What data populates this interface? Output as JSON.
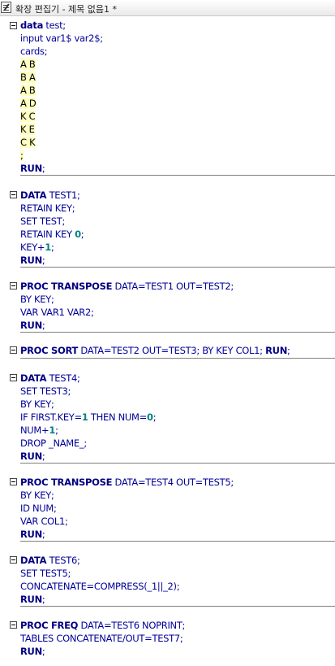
{
  "window": {
    "title": "확장 편집기 - 제목 없음1 *"
  },
  "lines": {
    "l1": {
      "kw": "data",
      "rest": " test;"
    },
    "l2": {
      "text": "input var1$ var2$;"
    },
    "l3": {
      "text": "cards;"
    },
    "l4": {
      "text": "A B"
    },
    "l5": {
      "text": "B A"
    },
    "l6": {
      "text": "A B"
    },
    "l7": {
      "text": "A D"
    },
    "l8": {
      "text": "K C"
    },
    "l9": {
      "text": "K E"
    },
    "l10": {
      "text": "C K"
    },
    "l11": {
      "text": ";"
    },
    "l12": {
      "kw": "RUN",
      "rest": ";"
    },
    "l13": {
      "kw": "DATA",
      "rest": " TEST1;"
    },
    "l14": {
      "text": "RETAIN KEY;"
    },
    "l15": {
      "text": "SET TEST;"
    },
    "l16": {
      "a": "RETAIN KEY ",
      "n": "0",
      "b": ";"
    },
    "l17": {
      "a": "KEY+",
      "n": "1",
      "b": ";"
    },
    "l18": {
      "kw": "RUN",
      "rest": ";"
    },
    "l19": {
      "kw": "PROC TRANSPOSE",
      "rest": " DATA=TEST1 OUT=TEST2;"
    },
    "l20": {
      "text": "BY KEY;"
    },
    "l21": {
      "text": "VAR VAR1 VAR2;"
    },
    "l22": {
      "kw": "RUN",
      "rest": ";"
    },
    "l23": {
      "kw": "PROC SORT",
      "rest": " DATA=TEST2 OUT=TEST3; BY KEY COL1; ",
      "kw2": "RUN",
      "rest2": ";"
    },
    "l24": {
      "kw": "DATA",
      "rest": " TEST4;"
    },
    "l25": {
      "text": "SET TEST3;"
    },
    "l26": {
      "text": "BY KEY;"
    },
    "l27": {
      "a": "IF FIRST.KEY=",
      "n": "1",
      "b": " THEN NUM=",
      "n2": "0",
      "c": ";"
    },
    "l28": {
      "a": "NUM+",
      "n": "1",
      "b": ";"
    },
    "l29": {
      "text": "DROP _NAME_;"
    },
    "l30": {
      "kw": "RUN",
      "rest": ";"
    },
    "l31": {
      "kw": "PROC TRANSPOSE",
      "rest": " DATA=TEST4 OUT=TEST5;"
    },
    "l32": {
      "text": "BY KEY;"
    },
    "l33": {
      "text": "ID NUM;"
    },
    "l34": {
      "text": "VAR COL1;"
    },
    "l35": {
      "kw": "RUN",
      "rest": ";"
    },
    "l36": {
      "kw": "DATA",
      "rest": " TEST6;"
    },
    "l37": {
      "text": "SET TEST5;"
    },
    "l38": {
      "text": "CONCATENATE=COMPRESS(_1||_2);"
    },
    "l39": {
      "kw": "RUN",
      "rest": ";"
    },
    "l40": {
      "kw": "PROC FREQ",
      "rest": " DATA=TEST6 NOPRINT;"
    },
    "l41": {
      "text": "TABLES CONCATENATE/OUT=TEST7;"
    },
    "l42": {
      "kw": "RUN",
      "rest": ";"
    }
  }
}
